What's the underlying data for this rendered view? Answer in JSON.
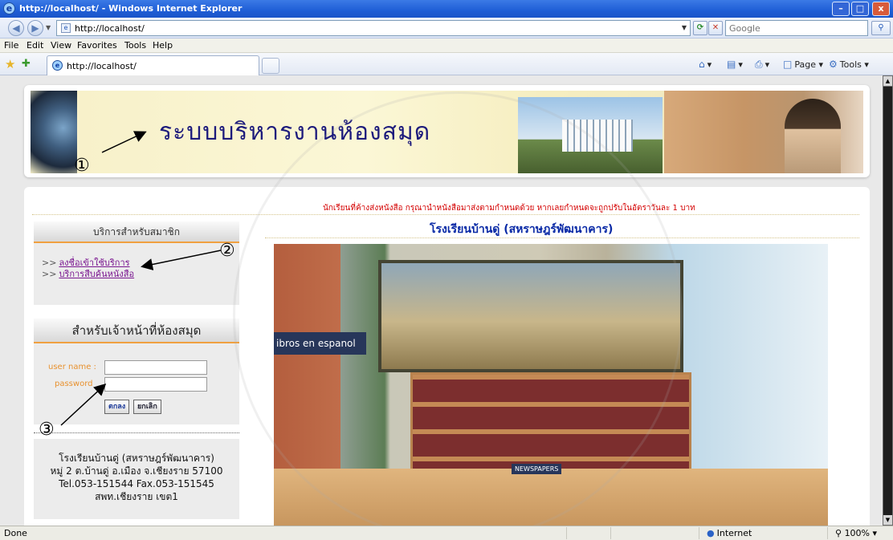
{
  "window": {
    "title": "http://localhost/ - Windows Internet Explorer",
    "min": "–",
    "max": "□",
    "close": "x"
  },
  "address_bar": {
    "url": "http://localhost/",
    "search_placeholder": "Google"
  },
  "menu": {
    "items": [
      "File",
      "Edit",
      "View",
      "Favorites",
      "Tools",
      "Help"
    ]
  },
  "tab": {
    "label": "http://localhost/"
  },
  "toolbar": {
    "page_label": "Page",
    "tools_label": "Tools"
  },
  "header": {
    "banner_title": "ระบบบริหารงานห้องสมุด"
  },
  "content": {
    "notice": "นักเรียนที่ค้างส่งหนังสือ กรุณานำหนังสือมาส่งตามกำหนดด้วย หากเลยกำหนดจะถูกปรับในอัตราวันละ 1 บาท",
    "school_title": "โรงเรียนบ้านดู่ (สหราษฎร์พัฒนาคาร)",
    "photo_sign": "ibros en espanol",
    "photo_sign2": "NEWSPAPERS"
  },
  "member_box": {
    "title": "บริการสำหรับสมาชิก",
    "links": [
      "ลงชื่อเข้าใช้บริการ",
      "บริการสืบค้นหนังสือ"
    ],
    "arrow": ">>"
  },
  "staff_box": {
    "title": "สำหรับเจ้าหน้าที่ห้องสมุด",
    "username_label": "user name :",
    "password_label": "password",
    "ok_button": "ตกลง",
    "cancel_button": "ยกเลิก"
  },
  "address": {
    "lines": [
      "โรงเรียนบ้านดู่ (สหราษฎร์พัฒนาคาร)",
      "หมู่ 2 ต.บ้านดู่ อ.เมือง จ.เชียงราย 57100",
      "Tel.053-151544 Fax.053-151545",
      "สพท.เชียงราย เขต1"
    ]
  },
  "annotations": {
    "n1": "①",
    "n2": "②",
    "n3": "③"
  },
  "status": {
    "text": "Done",
    "zone": "Internet",
    "zoom": "100%"
  }
}
